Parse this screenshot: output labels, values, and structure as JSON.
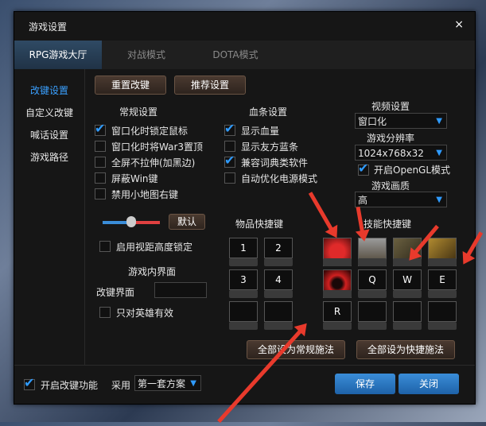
{
  "window": {
    "title": "游戏设置",
    "close_glyph": "×"
  },
  "tabs": [
    {
      "label": "RPG游戏大厅",
      "active": true
    },
    {
      "label": "对战模式"
    },
    {
      "label": "DOTA模式"
    }
  ],
  "sidebar": [
    {
      "label": "改键设置",
      "active": true
    },
    {
      "label": "自定义改键"
    },
    {
      "label": "喊话设置"
    },
    {
      "label": "游戏路径"
    }
  ],
  "top_buttons": {
    "reset": "重置改键",
    "recommend": "推荐设置"
  },
  "general": {
    "title": "常规设置",
    "options": [
      {
        "label": "窗口化时锁定鼠标",
        "checked": true
      },
      {
        "label": "窗口化时将War3置顶",
        "checked": false
      },
      {
        "label": "全屏不拉伸(加黑边)",
        "checked": false
      },
      {
        "label": "屏蔽Win键",
        "checked": false
      },
      {
        "label": "禁用小地图右键",
        "checked": false
      }
    ]
  },
  "bloodbar": {
    "title": "血条设置",
    "options": [
      {
        "label": "显示血量",
        "checked": true
      },
      {
        "label": "显示友方蓝条",
        "checked": false
      },
      {
        "label": "兼容词典类软件",
        "checked": true
      },
      {
        "label": "自动优化电源模式",
        "checked": false
      }
    ]
  },
  "video": {
    "title": "视频设置",
    "mode": "窗口化",
    "resolution_label": "游戏分辨率",
    "resolution": "1024x768x32",
    "opengl": {
      "label": "开启OpenGL模式",
      "checked": true
    },
    "quality_label": "游戏画质",
    "quality": "高"
  },
  "slider": {
    "default_label": "默认",
    "level": 0.5
  },
  "viewlock": {
    "label": "启用视距高度锁定",
    "checked": false
  },
  "ingame": {
    "title": "游戏内界面",
    "remap_label": "改键界面",
    "remap_value": "",
    "hero_only": {
      "label": "只对英雄有效",
      "checked": false
    }
  },
  "items": {
    "title": "物品快捷键",
    "keys": [
      "1",
      "2",
      "3",
      "4",
      "",
      ""
    ]
  },
  "skills": {
    "title": "技能快捷键",
    "icons": [
      "skill-icon-red-arrow",
      "skill-icon-shield",
      "skill-icon-swords",
      "skill-icon-hammer",
      "skill-icon-red-swirl"
    ],
    "keys": [
      "Q",
      "W",
      "E",
      "R",
      "",
      "",
      ""
    ]
  },
  "bottom_buttons": {
    "all_normal": "全部设为常规施法",
    "all_quick": "全部设为快捷施法"
  },
  "footer": {
    "enable": {
      "label": "开启改键功能",
      "checked": true
    },
    "use_label": "采用",
    "scheme": "第一套方案",
    "save": "保存",
    "close": "关闭"
  },
  "colors": {
    "accent": "#2f9bff",
    "annotation_arrow": "#e83a2c",
    "window_bg": "#161616"
  }
}
